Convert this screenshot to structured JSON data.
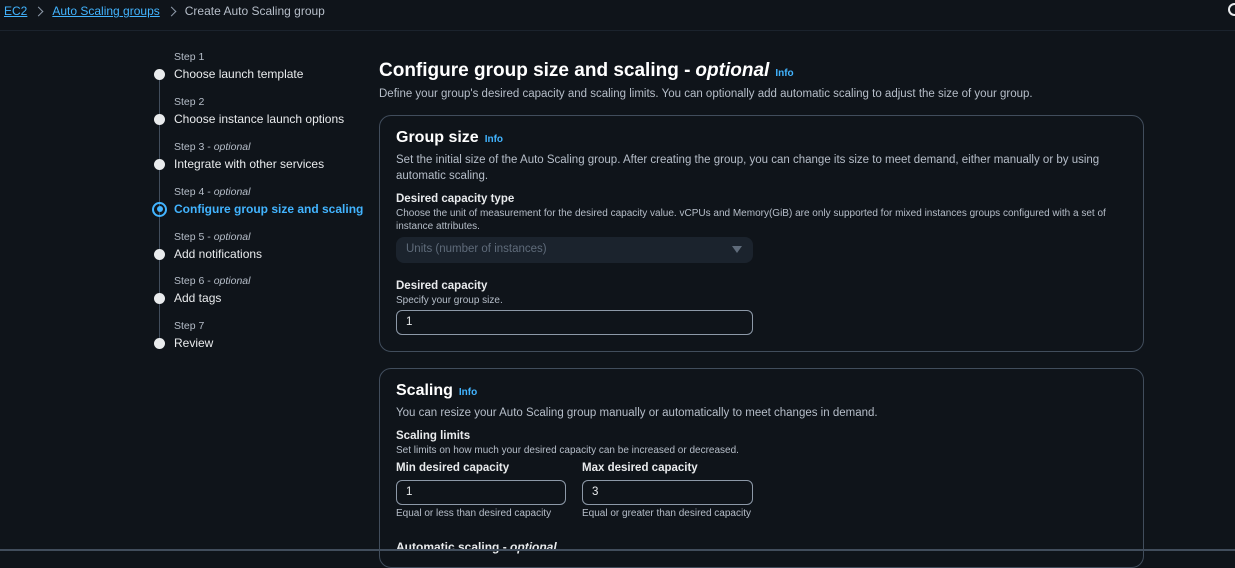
{
  "breadcrumb": {
    "items": [
      "EC2",
      "Auto Scaling groups"
    ],
    "current": "Create Auto Scaling group"
  },
  "steps": [
    {
      "label": "Step 1",
      "optional": "",
      "title": "Choose launch template"
    },
    {
      "label": "Step 2",
      "optional": "",
      "title": "Choose instance launch options"
    },
    {
      "label": "Step 3 - ",
      "optional": "optional",
      "title": "Integrate with other services"
    },
    {
      "label": "Step 4 - ",
      "optional": "optional",
      "title": "Configure group size and scaling"
    },
    {
      "label": "Step 5 - ",
      "optional": "optional",
      "title": "Add notifications"
    },
    {
      "label": "Step 6 - ",
      "optional": "optional",
      "title": "Add tags"
    },
    {
      "label": "Step 7",
      "optional": "",
      "title": "Review"
    }
  ],
  "active_step": 4,
  "page": {
    "title": "Configure group size and scaling -",
    "title_optional": "optional",
    "info": "Info",
    "description": "Define your group's desired capacity and scaling limits. You can optionally add automatic scaling to adjust the size of your group."
  },
  "group_size": {
    "title": "Group size",
    "info": "Info",
    "description": "Set the initial size of the Auto Scaling group. After creating the group, you can change its size to meet demand, either manually or by using automatic scaling.",
    "capacity_type_label": "Desired capacity type",
    "capacity_type_desc": "Choose the unit of measurement for the desired capacity value. vCPUs and Memory(GiB) are only supported for mixed instances groups configured with a set of instance attributes.",
    "capacity_type_value": "Units (number of instances)",
    "desired_capacity_label": "Desired capacity",
    "desired_capacity_desc": "Specify your group size.",
    "desired_capacity_value": "1"
  },
  "scaling": {
    "title": "Scaling",
    "info": "Info",
    "description": "You can resize your Auto Scaling group manually or automatically to meet changes in demand.",
    "limits_label": "Scaling limits",
    "limits_desc": "Set limits on how much your desired capacity can be increased or decreased.",
    "min_label": "Min desired capacity",
    "min_value": "1",
    "min_hint": "Equal or less than desired capacity",
    "max_label": "Max desired capacity",
    "max_value": "3",
    "max_hint": "Equal or greater than desired capacity",
    "auto_scaling_title": "Automatic scaling - ",
    "auto_scaling_optional": "optional"
  },
  "colors": {
    "background": "#0f141a",
    "link": "#42b4ff",
    "border": "#414d5c"
  }
}
